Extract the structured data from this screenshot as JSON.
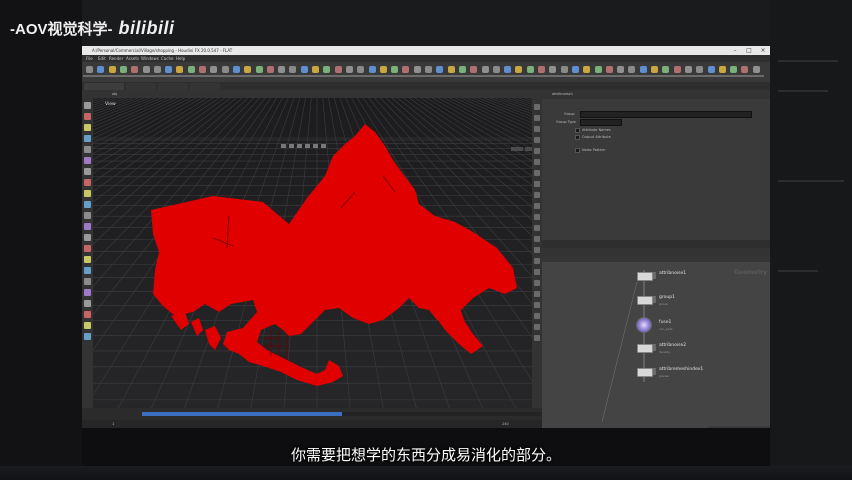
{
  "watermark": {
    "channel": "-AOV视觉科学-",
    "logo": "bilibili"
  },
  "app": {
    "title": "A:/Personal/Commercial/Village/shopping - Houdini FX 20.0.547 - FLAT",
    "menu": [
      "File",
      "Edit",
      "Render",
      "Assets",
      "Windows",
      "Cache",
      "Help"
    ],
    "viewport_label": "View",
    "node_path": "obj",
    "param_node": "attribnoise1",
    "param_fields": [
      "Group",
      "Group Type",
      "Attribute Names",
      "Output Attribute",
      "Noise Pattern"
    ],
    "timeline": {
      "start": "1",
      "end": "240",
      "progress": 0.5
    }
  },
  "network": {
    "context_label": "Geometry",
    "nodes": [
      {
        "name": "attribnoise1",
        "sub": "obj\ndensity",
        "type": "attribnoise"
      },
      {
        "name": "group1",
        "sub": "group",
        "type": "group"
      },
      {
        "name": "fuse1",
        "sub": "con_post",
        "type": "fuse"
      },
      {
        "name": "attribnoise2",
        "sub": "density",
        "type": "attribnoise"
      },
      {
        "name": "attribremeshindex1",
        "sub": "planes",
        "type": "attribremeshindex"
      }
    ]
  },
  "subtitle": "你需要把想学的东西分成易消化的部分。",
  "colors": {
    "geometry": "#e00000",
    "timeline_fill": "#3b6ec0",
    "viewport_bg": "#1f1f21"
  }
}
